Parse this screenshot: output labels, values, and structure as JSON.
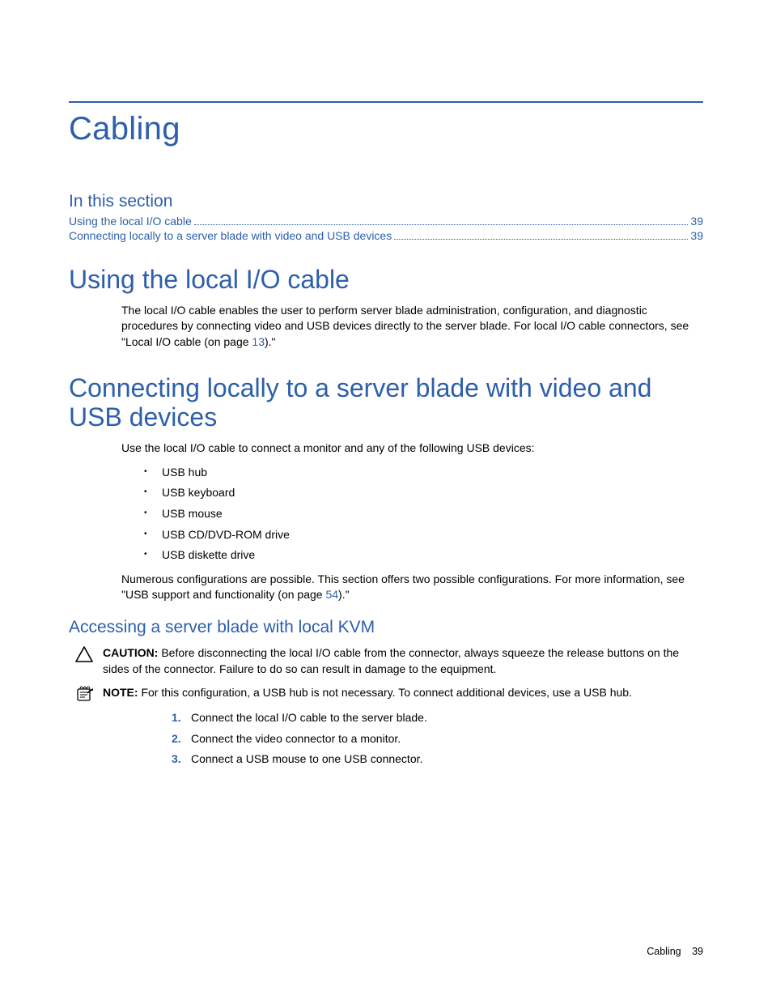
{
  "title": "Cabling",
  "toc": {
    "heading": "In this section",
    "items": [
      {
        "label": "Using the local I/O cable",
        "page": "39"
      },
      {
        "label": "Connecting locally to a server blade with video and USB devices",
        "page": "39"
      }
    ]
  },
  "s1": {
    "heading": "Using the local I/O cable",
    "p1a": "The local I/O cable enables the user to perform server blade administration, configuration, and diagnostic procedures by connecting video and USB devices directly to the server blade. For local I/O cable connectors, see \"Local I/O cable (on page ",
    "p1link": "13",
    "p1b": ").\""
  },
  "s2": {
    "heading": "Connecting locally to a server blade with video and USB devices",
    "p1": "Use the local I/O cable to connect a monitor and any of the following USB devices:",
    "bullets": [
      "USB hub",
      "USB keyboard",
      "USB mouse",
      "USB CD/DVD-ROM drive",
      "USB diskette drive"
    ],
    "p2a": "Numerous configurations are possible. This section offers two possible configurations. For more information, see \"USB support and functionality (on page ",
    "p2link": "54",
    "p2b": ").\""
  },
  "s3": {
    "heading": "Accessing a server blade with local KVM",
    "caution_label": "CAUTION:",
    "caution_text": "  Before disconnecting the local I/O cable from the connector, always squeeze the release buttons on the sides of the connector. Failure to do so can result in damage to the equipment.",
    "note_label": "NOTE:",
    "note_text": "  For this configuration, a USB hub is not necessary. To connect additional devices, use a USB hub.",
    "steps": [
      "Connect the local I/O cable to the server blade.",
      "Connect the video connector to a monitor.",
      "Connect a USB mouse to one USB connector."
    ]
  },
  "footer": {
    "section": "Cabling",
    "page": "39"
  }
}
